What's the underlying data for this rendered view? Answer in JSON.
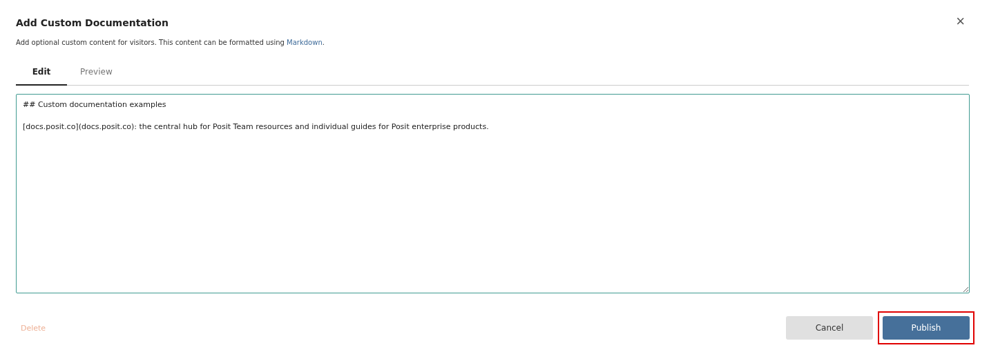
{
  "dialog": {
    "title": "Add Custom Documentation",
    "close_icon": "×",
    "description_prefix": "Add optional custom content for visitors. This content can be formatted using ",
    "description_link": "Markdown",
    "description_suffix": "."
  },
  "tabs": [
    {
      "label": "Edit",
      "selected": true
    },
    {
      "label": "Preview",
      "selected": false
    }
  ],
  "editor": {
    "value": "## Custom documentation examples\n\n[docs.posit.co](docs.posit.co): the central hub for Posit Team resources and individual guides for Posit enterprise products."
  },
  "footer": {
    "delete": {
      "label": "Delete",
      "disabled": true
    },
    "cancel": {
      "label": "Cancel"
    },
    "publish": {
      "label": "Publish",
      "highlighted": true
    }
  }
}
